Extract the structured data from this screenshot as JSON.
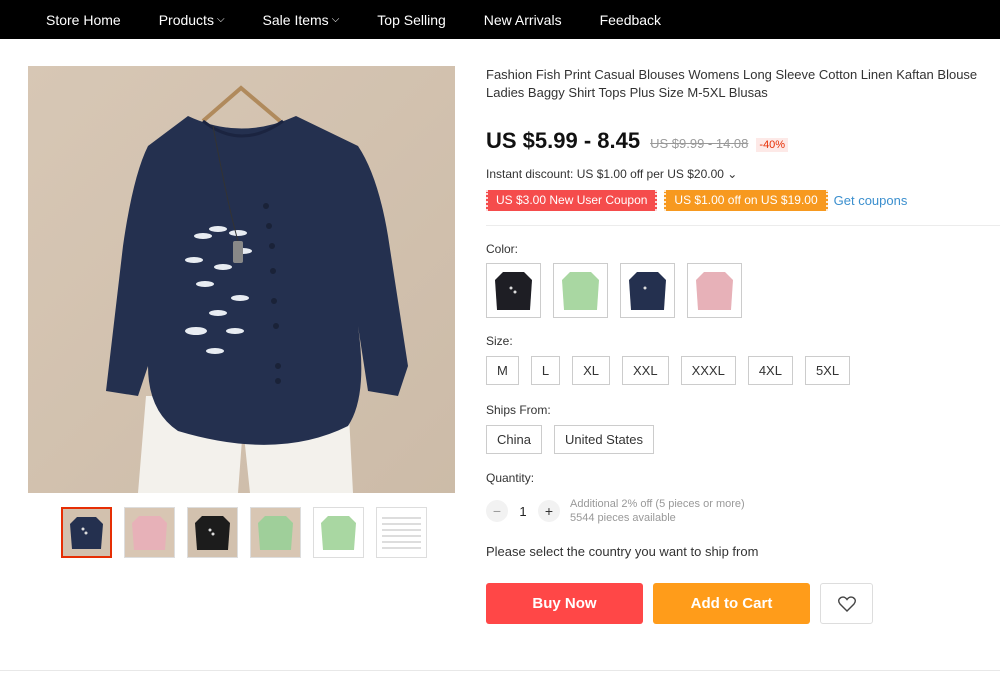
{
  "nav": {
    "items": [
      {
        "label": "Store Home",
        "dropdown": false
      },
      {
        "label": "Products",
        "dropdown": true
      },
      {
        "label": "Sale Items",
        "dropdown": true
      },
      {
        "label": "Top Selling",
        "dropdown": false
      },
      {
        "label": "New Arrivals",
        "dropdown": false
      },
      {
        "label": "Feedback",
        "dropdown": false
      }
    ]
  },
  "product": {
    "title": "Fashion Fish Print Casual Blouses Womens Long Sleeve Cotton Linen Kaftan Blouse Ladies Baggy Shirt Tops Plus Size M-5XL Blusas",
    "price": "US $5.99 - 8.45",
    "old_price": "US $9.99 - 14.08",
    "discount": "-40%",
    "instant_discount": "Instant discount: US $1.00 off per US $20.00 ⌄",
    "coupon_new_user": "US $3.00 New User Coupon",
    "coupon_off": "US $1.00 off on US $19.00",
    "get_coupons": "Get coupons"
  },
  "options": {
    "color_label": "Color:",
    "colors": [
      "navy-fish",
      "green",
      "navy",
      "pink"
    ],
    "size_label": "Size:",
    "sizes": [
      "M",
      "L",
      "XL",
      "XXL",
      "XXXL",
      "4XL",
      "5XL"
    ],
    "ships_label": "Ships From:",
    "ships": [
      "China",
      "United States"
    ],
    "quantity_label": "Quantity:",
    "quantity": "1",
    "qty_note_1": "Additional 2% off (5 pieces or more)",
    "qty_note_2": "5544 pieces available",
    "minus": "−",
    "plus": "+"
  },
  "ship_message": "Please select the country you want to ship from",
  "actions": {
    "buy": "Buy Now",
    "cart": "Add to Cart"
  },
  "colors": {
    "accent_red": "#ff4747",
    "accent_orange": "#ff9c1a",
    "link_blue": "#3b8fce"
  }
}
